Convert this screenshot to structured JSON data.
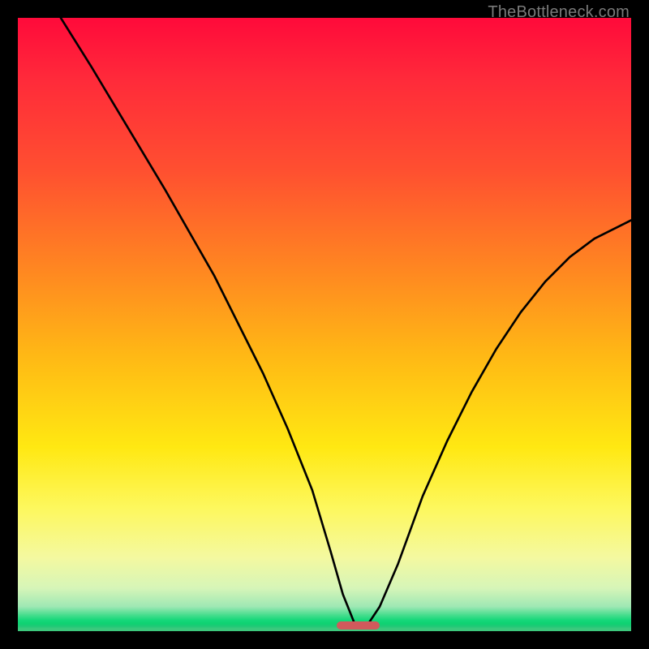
{
  "watermark": "TheBottleneck.com",
  "colors": {
    "frame": "#000000",
    "gradient_top": "#ff0a3a",
    "gradient_bottom": "#3cc97d",
    "curve": "#000000",
    "marker": "#d15a5c",
    "watermark": "#7a7a7a"
  },
  "chart_data": {
    "type": "line",
    "title": "",
    "xlabel": "",
    "ylabel": "",
    "xlim": [
      0,
      100
    ],
    "ylim": [
      0,
      100
    ],
    "grid": false,
    "legend": null,
    "annotations": [],
    "marker": {
      "x_start": 52,
      "x_end": 59,
      "y": 0
    },
    "series": [
      {
        "name": "curve",
        "x": [
          7,
          12,
          18,
          24,
          28,
          32,
          36,
          40,
          44,
          48,
          51,
          53,
          55,
          57,
          59,
          62,
          66,
          70,
          74,
          78,
          82,
          86,
          90,
          94,
          98,
          100
        ],
        "y": [
          100,
          92,
          82,
          72,
          65,
          58,
          50,
          42,
          33,
          23,
          13,
          6,
          1,
          1,
          4,
          11,
          22,
          31,
          39,
          46,
          52,
          57,
          61,
          64,
          66,
          67
        ]
      }
    ]
  }
}
